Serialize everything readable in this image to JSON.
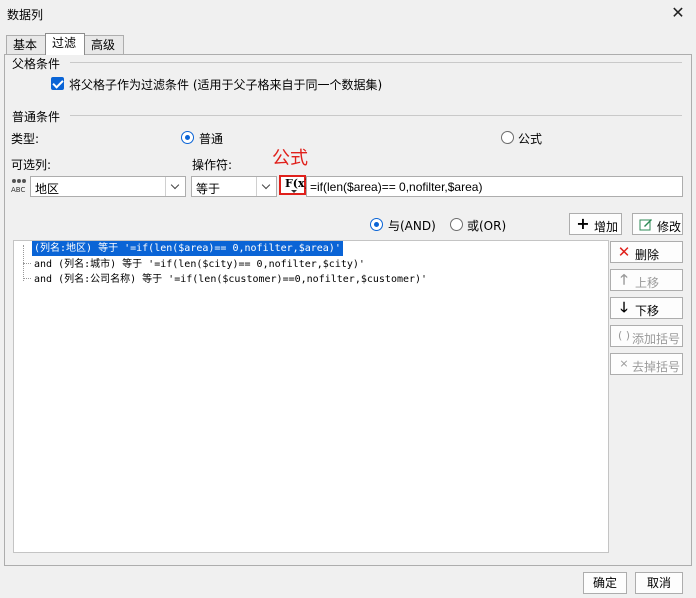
{
  "window": {
    "title": "数据列",
    "close_glyph": "✕"
  },
  "tabs": [
    {
      "label": "基本"
    },
    {
      "label": "过滤"
    },
    {
      "label": "高级"
    }
  ],
  "parent_condition": {
    "title": "父格条件",
    "checkbox_label": "将父格子作为过滤条件 (适用于父子格来自于同一个数据集)",
    "checked": true
  },
  "normal_condition": {
    "title": "普通条件",
    "type_label": "类型:",
    "type_options": [
      {
        "label": "普通",
        "selected": true
      },
      {
        "label": "公式",
        "selected": false
      }
    ],
    "column_label": "可选列:",
    "operator_label": "操作符:",
    "column_value": "地区",
    "operator_value": "等于",
    "formula_value": "=if(len($area)== 0,nofilter,$area)",
    "annotation": "公式",
    "fx_text": "F(x)",
    "column_icon_text": "ABC"
  },
  "logic": {
    "and_label": "与(AND)",
    "or_label": "或(OR)",
    "and_selected": true,
    "add_label": "增加",
    "edit_label": "修改"
  },
  "conditions": [
    {
      "text": "(列名:地区) 等于 '=if(len($area)== 0,nofilter,$area)'",
      "selected": true
    },
    {
      "text": "and (列名:城市) 等于 '=if(len($city)== 0,nofilter,$city)'",
      "selected": false
    },
    {
      "text": "and (列名:公司名称) 等于 '=if(len($customer)==0,nofilter,$customer)'",
      "selected": false
    }
  ],
  "side_buttons": {
    "delete_label": "删除",
    "up_label": "上移",
    "down_label": "下移",
    "add_bracket_label": "添加括号",
    "remove_bracket_label": "去掉括号"
  },
  "footer": {
    "ok_label": "确定",
    "cancel_label": "取消"
  },
  "colors": {
    "accent": "#0a64d6",
    "annotation_red": "#e0201b"
  }
}
